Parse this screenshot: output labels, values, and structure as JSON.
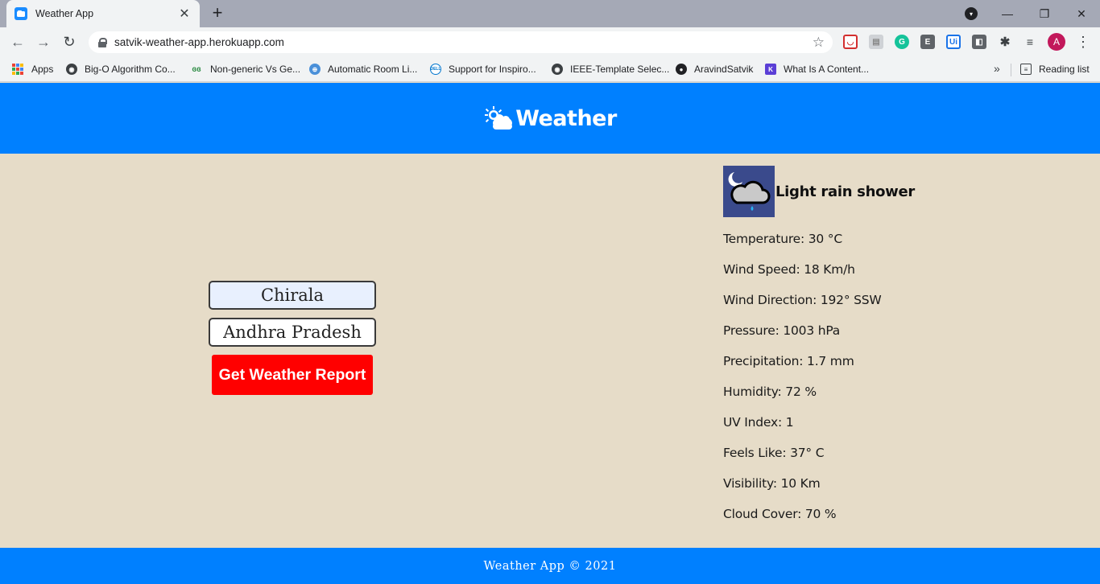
{
  "browser": {
    "tab_title": "Weather App",
    "tab_close": "✕",
    "new_tab": "+",
    "url": "satvik-weather-app.herokuapp.com",
    "avatar_letter": "A",
    "win_minimize": "—",
    "win_restore": "❐",
    "win_close": "✕",
    "nav_back": "←",
    "nav_forward": "→",
    "nav_reload": "↻",
    "star": "☆",
    "menu": "⋮",
    "bookmarks": [
      {
        "label": "Apps",
        "icon": "apps-grid-icon"
      },
      {
        "label": "Big-O Algorithm Co...",
        "icon": "globe-icon"
      },
      {
        "label": "Non-generic Vs Ge...",
        "icon": "gfg-icon"
      },
      {
        "label": "Automatic Room Li...",
        "icon": "globe-blue-icon"
      },
      {
        "label": "Support for Inspiro...",
        "icon": "dell-icon"
      },
      {
        "label": "IEEE-Template Selec...",
        "icon": "globe-icon"
      },
      {
        "label": "AravindSatvik",
        "icon": "github-icon"
      },
      {
        "label": "What Is A Content...",
        "icon": "k-icon"
      }
    ],
    "bookmarks_more": "»",
    "reading_list": "Reading list",
    "colors": {
      "tabstrip": "#a5a9b6",
      "toolbar": "#f1f3f4",
      "avatar": "#c2185b"
    }
  },
  "header": {
    "title": "Weather",
    "logo_icon": "sun-cloud-icon",
    "color": "#0080ff"
  },
  "form": {
    "city_value": "Chirala",
    "state_value": "Andhra Pradesh",
    "submit_label": "Get Weather Report",
    "submit_color": "#ff0000"
  },
  "report": {
    "condition": "Light rain shower",
    "condition_icon": "night-rain-cloud-icon",
    "stats": [
      "Temperature: 30 °C",
      "Wind Speed: 18 Km/h",
      "Wind Direction: 192° SSW",
      "Pressure: 1003 hPa",
      "Precipitation: 1.7 mm",
      "Humidity: 72 %",
      "UV Index: 1",
      "Feels Like: 37° C",
      "Visibility: 10 Km",
      "Cloud Cover: 70 %"
    ]
  },
  "footer": {
    "text": "Weather App © 2021",
    "color": "#0080ff"
  },
  "page_background": "#e6dcc8"
}
